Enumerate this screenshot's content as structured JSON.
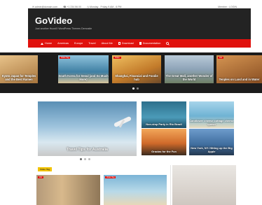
{
  "topbar": {
    "email": "✉ admin@domain.com",
    "phone": "☎ +1 234 56 00",
    "hours": "◷ Monday - Friday 9 AM - 6 PM",
    "right": "Member · LOGIN"
  },
  "header": {
    "logo": "GoVideo",
    "tagline": "Just another HuoxiX WordPress Themes Demosite"
  },
  "nav": [
    {
      "label": "Home"
    },
    {
      "label": "Americas"
    },
    {
      "label": "Europe"
    },
    {
      "label": "Travel"
    },
    {
      "label": "About Me"
    },
    {
      "label": "Download"
    },
    {
      "label": "Documentation"
    },
    {
      "label": ""
    }
  ],
  "carousel": [
    {
      "caption": "Kyoto Japan for Temples and the Best Ramen",
      "badge": "",
      "color": "#c9a46a"
    },
    {
      "caption": "South Korea for Seoul (and So Much More)",
      "badge": "Video Tag",
      "color": "#6fa6c4"
    },
    {
      "caption": "Shanghai, Financial and Foodie hub",
      "badge": "Video",
      "color": "#d9a040"
    },
    {
      "caption": "The Great Wall, another Wonder of the World",
      "badge": "",
      "color": "#9db0c2"
    },
    {
      "caption": "Tenples on Land and in Water",
      "badge": "Hot",
      "color": "#b8763e"
    }
  ],
  "featured": {
    "main_caption": "Travel Tips for Australia",
    "side": [
      {
        "caption": "Non-stop Party in Rio Brazil",
        "color": "#3a7f9e"
      },
      {
        "caption": "Candlower cheese cottage cheese queso",
        "color": "#7fb8d6"
      },
      {
        "caption": "Gracias for the Fun",
        "color": "#c97a3e"
      },
      {
        "caption": "New York, NY: Hitting up the Big Apple",
        "color": "#5a86b0"
      }
    ]
  },
  "bottom": {
    "category_badge": "Video Tag",
    "card1_badge": "Hot",
    "card2_badge": "Video Tag"
  }
}
